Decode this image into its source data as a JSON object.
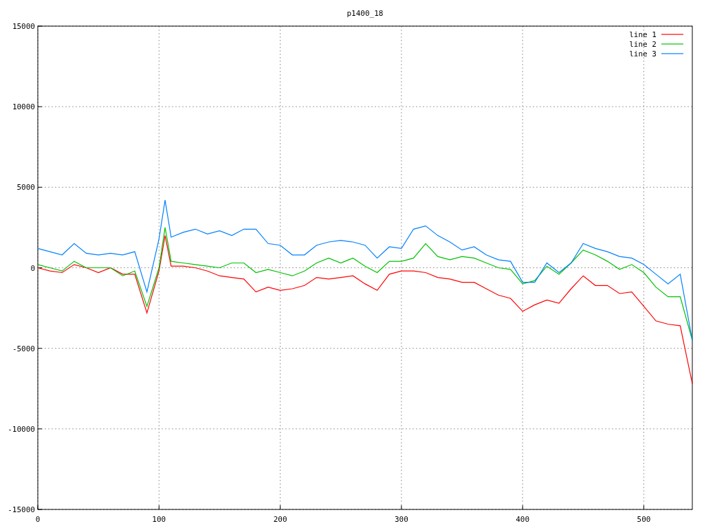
{
  "chart_data": {
    "type": "line",
    "title": "p1400_18",
    "x": [
      0,
      10,
      20,
      30,
      40,
      50,
      60,
      70,
      80,
      90,
      100,
      105,
      110,
      120,
      130,
      140,
      150,
      160,
      170,
      180,
      190,
      200,
      210,
      220,
      230,
      240,
      250,
      260,
      270,
      280,
      290,
      300,
      310,
      320,
      330,
      340,
      350,
      360,
      370,
      380,
      390,
      400,
      410,
      420,
      430,
      440,
      450,
      460,
      470,
      480,
      490,
      500,
      510,
      520,
      530,
      540
    ],
    "series": [
      {
        "name": "line 1",
        "color": "#ff0000",
        "values": [
          0,
          -200,
          -300,
          200,
          0,
          -300,
          0,
          -400,
          -400,
          -2800,
          -200,
          2000,
          100,
          100,
          0,
          -200,
          -500,
          -600,
          -700,
          -1500,
          -1200,
          -1400,
          -1300,
          -1100,
          -600,
          -700,
          -600,
          -500,
          -1000,
          -1400,
          -400,
          -200,
          -200,
          -300,
          -600,
          -700,
          -900,
          -900,
          -1300,
          -1700,
          -1900,
          -2700,
          -2300,
          -2000,
          -2200,
          -1300,
          -500,
          -1100,
          -1100,
          -1600,
          -1500,
          -2400,
          -3300,
          -3500,
          -3600,
          -7200
        ]
      },
      {
        "name": "line 2",
        "color": "#00c000",
        "values": [
          200,
          0,
          -200,
          400,
          0,
          0,
          0,
          -500,
          -200,
          -2400,
          0,
          2500,
          400,
          300,
          200,
          100,
          0,
          300,
          300,
          -300,
          -100,
          -300,
          -500,
          -200,
          300,
          600,
          300,
          600,
          100,
          -300,
          400,
          400,
          600,
          1500,
          700,
          500,
          700,
          600,
          300,
          0,
          -100,
          -1000,
          -800,
          100,
          -400,
          300,
          1100,
          800,
          400,
          -100,
          200,
          -300,
          -1200,
          -1800,
          -1800,
          -4500
        ]
      },
      {
        "name": "line 3",
        "color": "#0080ff",
        "values": [
          1200,
          1000,
          800,
          1500,
          900,
          800,
          900,
          800,
          1000,
          -1500,
          1800,
          4200,
          1900,
          2200,
          2400,
          2100,
          2300,
          2000,
          2400,
          2400,
          1500,
          1400,
          800,
          800,
          1400,
          1600,
          1700,
          1600,
          1400,
          600,
          1300,
          1200,
          2400,
          2600,
          2000,
          1600,
          1100,
          1300,
          800,
          500,
          400,
          -900,
          -900,
          300,
          -300,
          300,
          1500,
          1200,
          1000,
          700,
          600,
          200,
          -400,
          -1000,
          -400,
          -4500
        ]
      }
    ],
    "xlim": [
      0,
      540
    ],
    "ylim": [
      -15000,
      15000
    ],
    "xticks": [
      0,
      100,
      200,
      300,
      400,
      500
    ],
    "yticks": [
      -15000,
      -10000,
      -5000,
      0,
      5000,
      10000,
      15000
    ],
    "grid": true,
    "legend": true
  }
}
